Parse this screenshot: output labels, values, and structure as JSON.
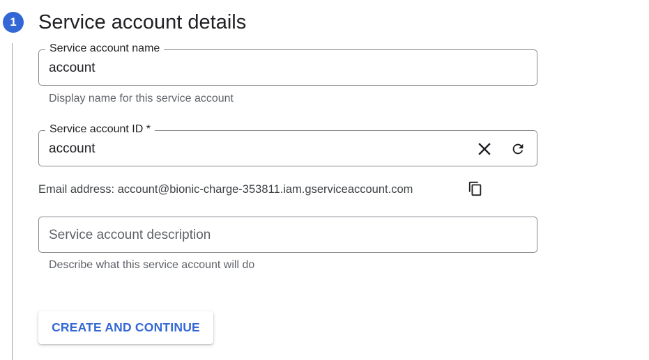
{
  "step": {
    "number": "1",
    "title": "Service account details"
  },
  "name_field": {
    "label": "Service account name",
    "value": "account",
    "hint": "Display name for this service account"
  },
  "id_field": {
    "label": "Service account ID *",
    "value": "account",
    "clear_icon": "close-icon",
    "refresh_icon": "refresh-icon"
  },
  "email": {
    "text": "Email address: account@bionic-charge-353811.iam.gserviceaccount.com",
    "copy_icon": "copy-icon"
  },
  "description_field": {
    "placeholder": "Service account description",
    "value": "",
    "hint": "Describe what this service account will do"
  },
  "actions": {
    "create_label": "CREATE AND CONTINUE"
  },
  "colors": {
    "accent": "#3367d6",
    "border": "#80868b",
    "hint_text": "#5f6368"
  }
}
